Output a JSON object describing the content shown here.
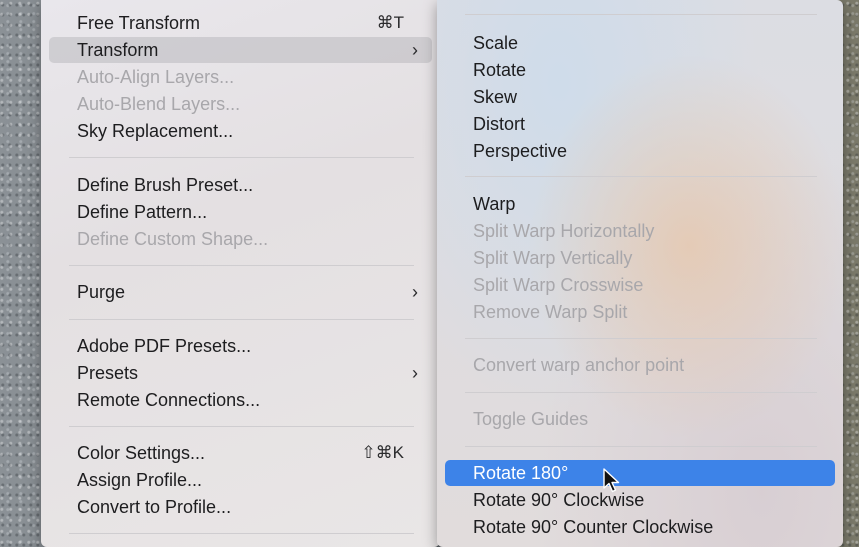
{
  "edit_menu": {
    "items": [
      {
        "label": "Free Transform",
        "shortcut": "⌘T"
      },
      {
        "label": "Transform"
      },
      {
        "label": "Auto-Align Layers..."
      },
      {
        "label": "Auto-Blend Layers..."
      },
      {
        "label": "Sky Replacement..."
      },
      {
        "label": "Define Brush Preset..."
      },
      {
        "label": "Define Pattern..."
      },
      {
        "label": "Define Custom Shape..."
      },
      {
        "label": "Purge"
      },
      {
        "label": "Adobe PDF Presets..."
      },
      {
        "label": "Presets"
      },
      {
        "label": "Remote Connections..."
      },
      {
        "label": "Color Settings...",
        "shortcut": "⇧⌘K"
      },
      {
        "label": "Assign Profile..."
      },
      {
        "label": "Convert to Profile..."
      }
    ],
    "submenu_indicator": "›"
  },
  "transform_submenu": {
    "items": [
      {
        "label": "Scale"
      },
      {
        "label": "Rotate"
      },
      {
        "label": "Skew"
      },
      {
        "label": "Distort"
      },
      {
        "label": "Perspective"
      },
      {
        "label": "Warp"
      },
      {
        "label": "Split Warp Horizontally"
      },
      {
        "label": "Split Warp Vertically"
      },
      {
        "label": "Split Warp Crosswise"
      },
      {
        "label": "Remove Warp Split"
      },
      {
        "label": "Convert warp anchor point"
      },
      {
        "label": "Toggle Guides"
      },
      {
        "label": "Rotate 180°"
      },
      {
        "label": "Rotate 90° Clockwise"
      },
      {
        "label": "Rotate 90° Counter Clockwise"
      }
    ]
  },
  "colors": {
    "selection": "#3d83e8",
    "disabled_text": "#a8a7ab",
    "text": "#1d1d1f"
  }
}
